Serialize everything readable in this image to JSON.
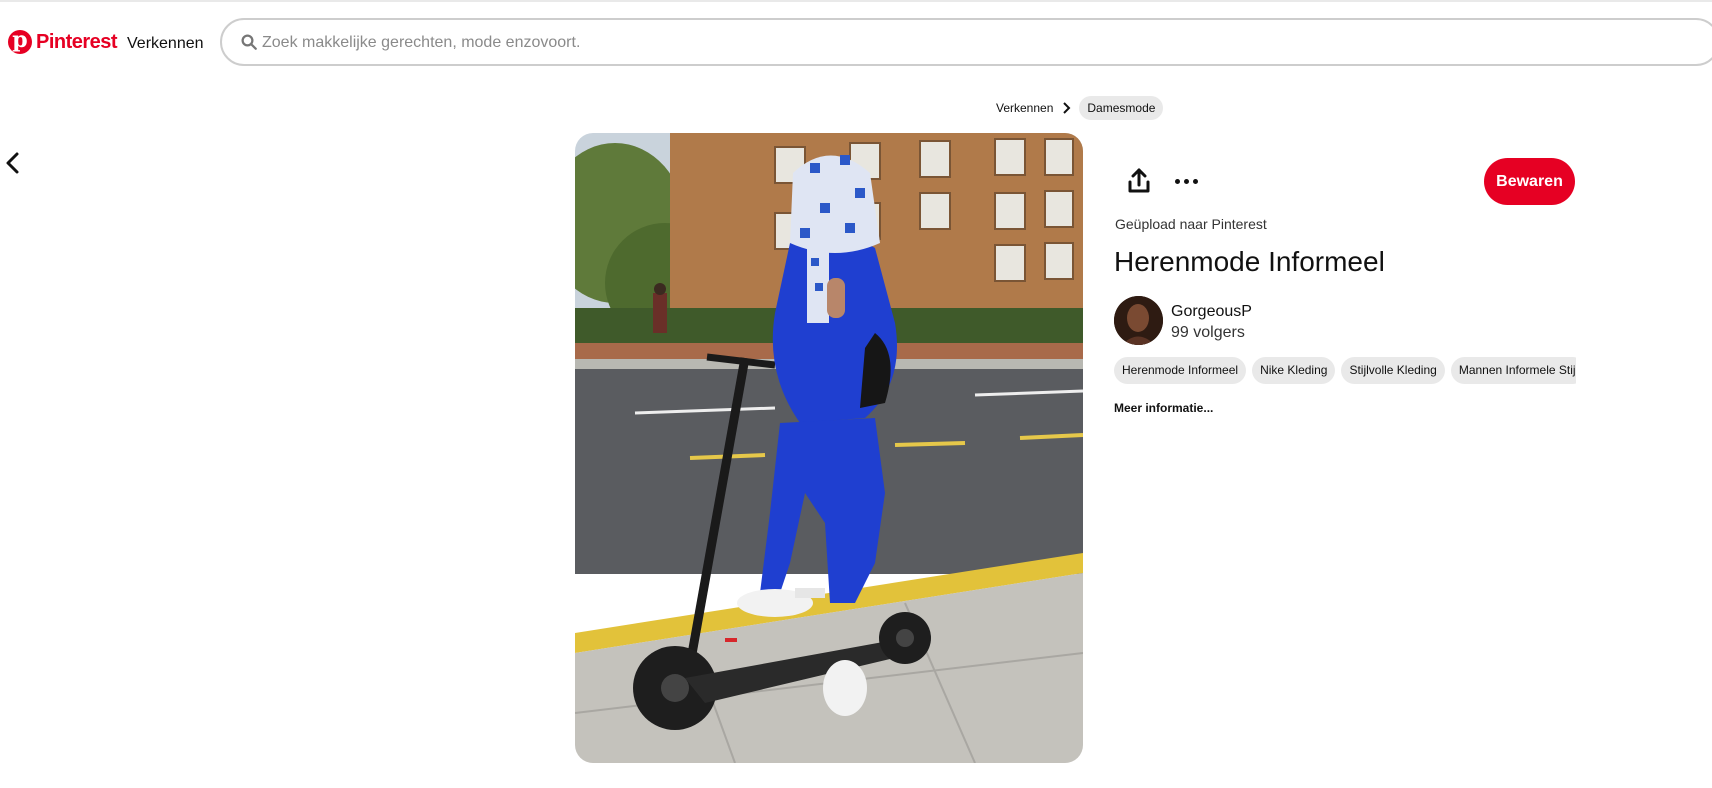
{
  "header": {
    "logo_text": "Pinterest",
    "explore_label": "Verkennen",
    "search": {
      "placeholder": "Zoek makkelijke gerechten, mode enzovoort.",
      "value": ""
    }
  },
  "breadcrumb": {
    "items": [
      {
        "label": "Verkennen"
      },
      {
        "label": "Damesmode"
      }
    ]
  },
  "pin": {
    "save_label": "Bewaren",
    "uploaded_text": "Geüpload naar Pinterest",
    "title": "Herenmode Informeel",
    "creator": {
      "name": "GorgeousP",
      "followers": "99 volgers"
    },
    "tags": [
      "Herenmode Informeel",
      "Nike Kleding",
      "Stijlvolle Kleding",
      "Mannen Informele Stijl"
    ],
    "more_info_label": "Meer informatie..."
  },
  "colors": {
    "brand": "#e60023",
    "chip_bg": "#e9e9e9",
    "tracksuit_blue": "#1f3fd0"
  },
  "icons": [
    "pinterest-logo-icon",
    "search-icon",
    "chevron-right-icon",
    "back-arrow-icon",
    "share-icon",
    "more-options-icon"
  ]
}
